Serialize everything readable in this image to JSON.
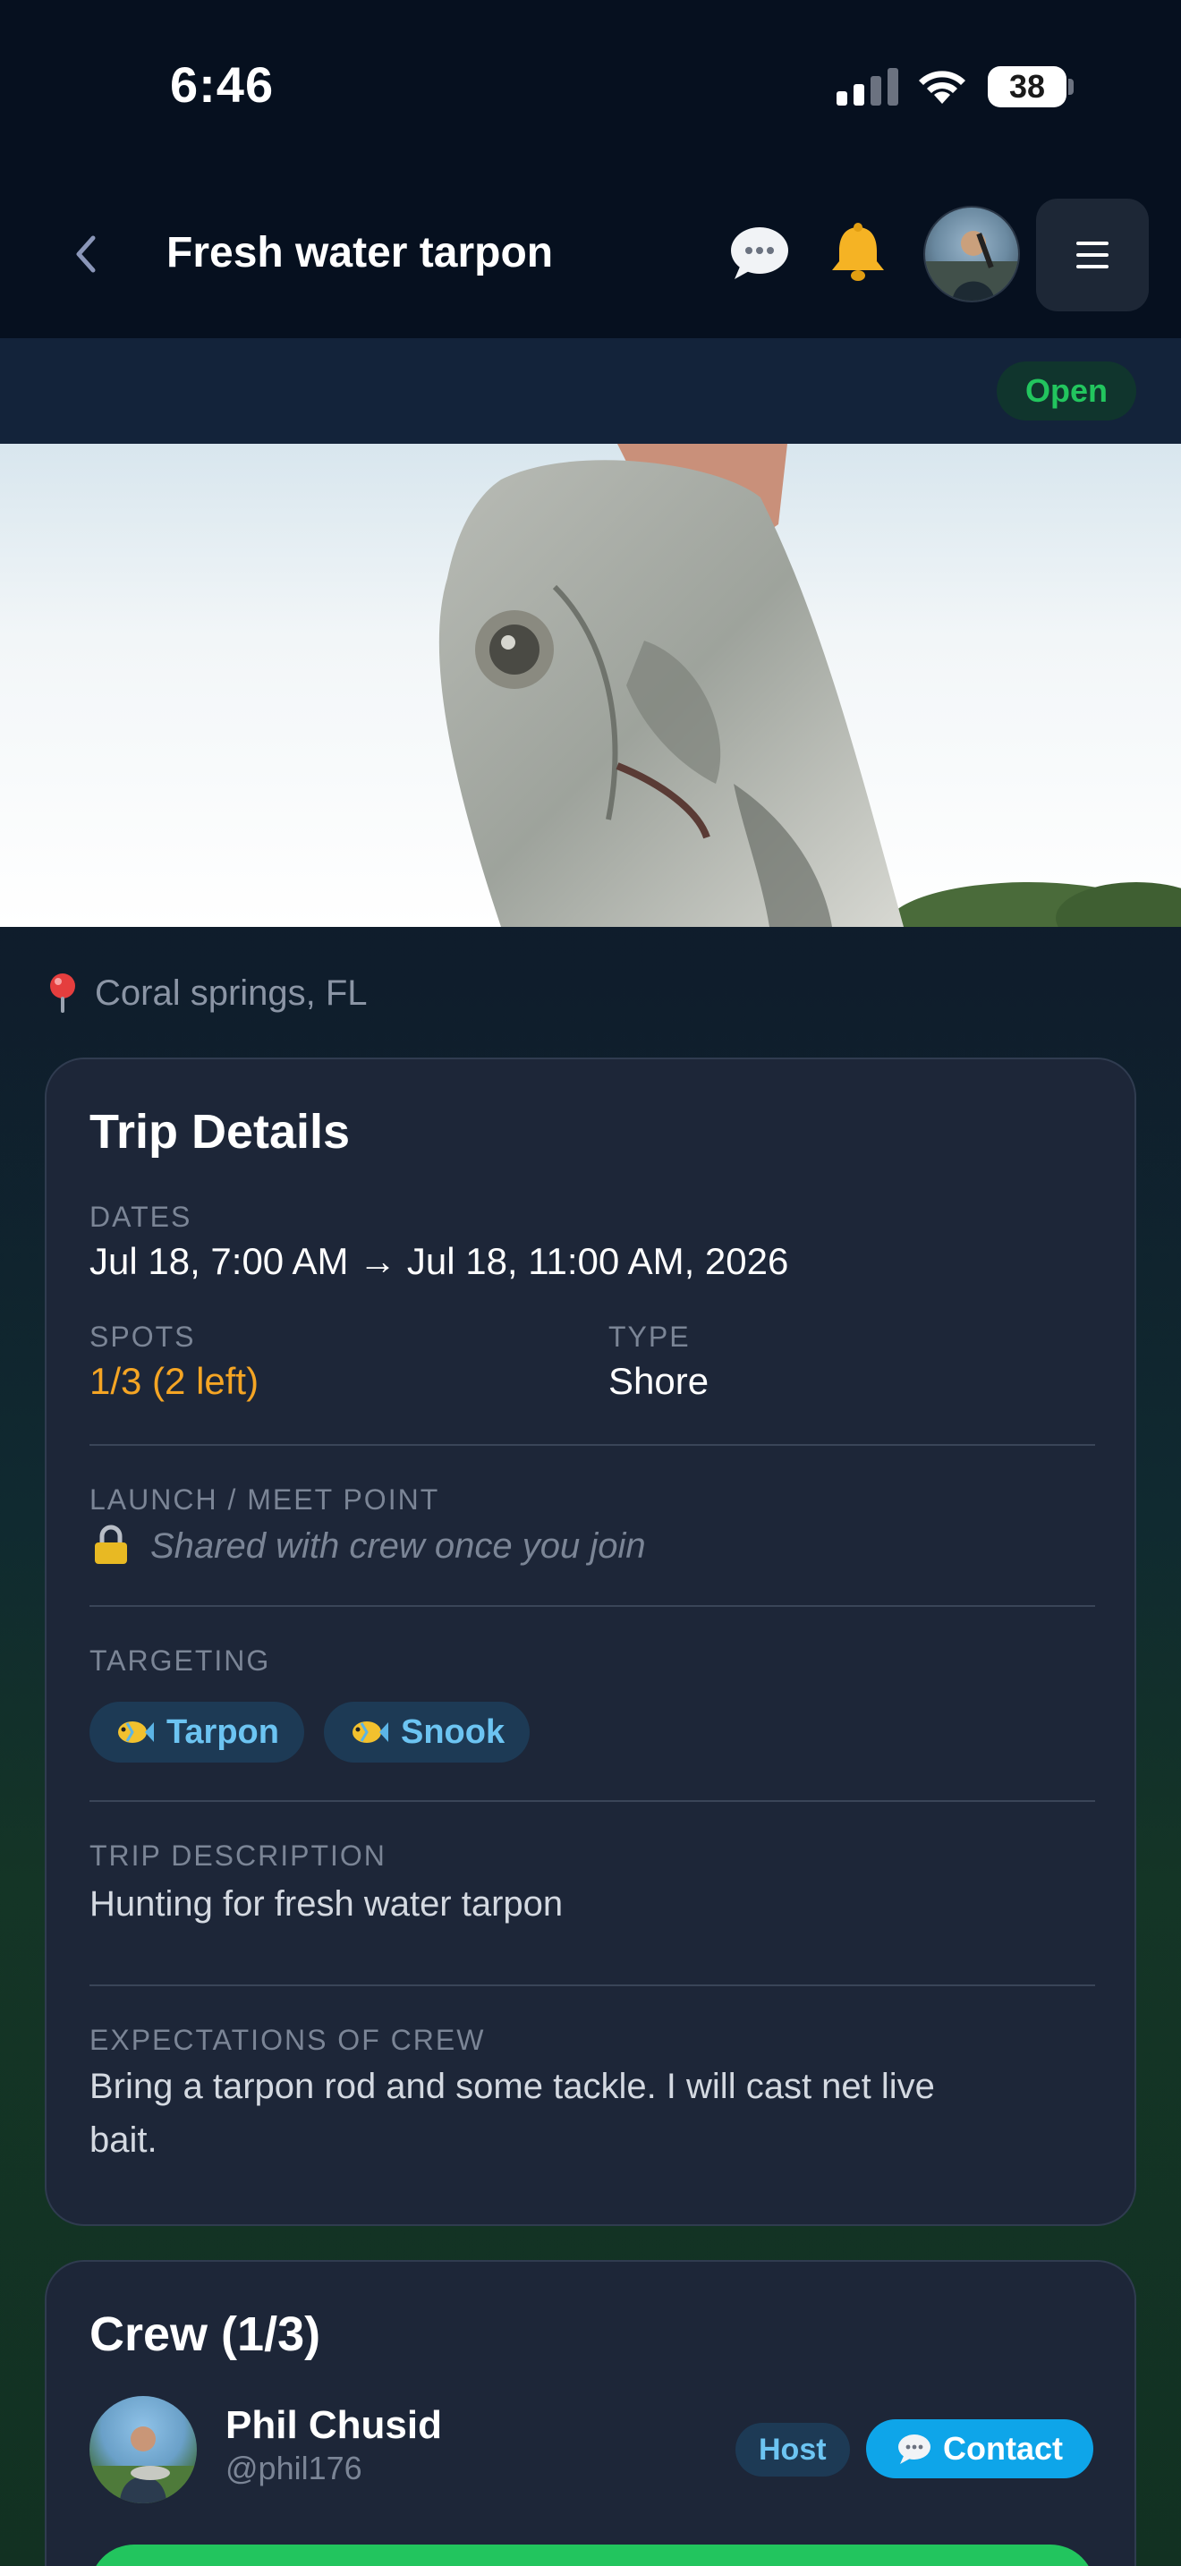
{
  "status_bar": {
    "time": "6:46",
    "battery": "38"
  },
  "header": {
    "title": "Fresh water tarpon"
  },
  "trip_status": "Open",
  "location": "Coral springs, FL",
  "trip_details": {
    "title": "Trip Details",
    "dates_label": "DATES",
    "dates_value": "Jul 18, 7:00 AM → Jul 18, 11:00 AM, 2026",
    "spots_label": "SPOTS",
    "spots_value": "1/3 (2 left)",
    "type_label": "TYPE",
    "type_value": "Shore",
    "launch_label": "LAUNCH / MEET POINT",
    "launch_value": "Shared with crew once you join",
    "targeting_label": "TARGETING",
    "targets": [
      "Tarpon",
      "Snook"
    ],
    "description_label": "TRIP DESCRIPTION",
    "description_value": "Hunting for fresh water tarpon",
    "expectations_label": "EXPECTATIONS OF CREW",
    "expectations_line1": "Bring a tarpon rod and some tackle. I will  cast net live",
    "expectations_line2": "bait."
  },
  "crew": {
    "title": "Crew (1/3)",
    "member_name": "Phil Chusid",
    "member_handle": "@phil176",
    "host_label": "Host",
    "contact_label": "Contact"
  },
  "colors": {
    "accent_green": "#22c55e",
    "accent_blue": "#0ea5e9",
    "spots_orange": "#f5a524",
    "card_bg": "#1d2638"
  }
}
